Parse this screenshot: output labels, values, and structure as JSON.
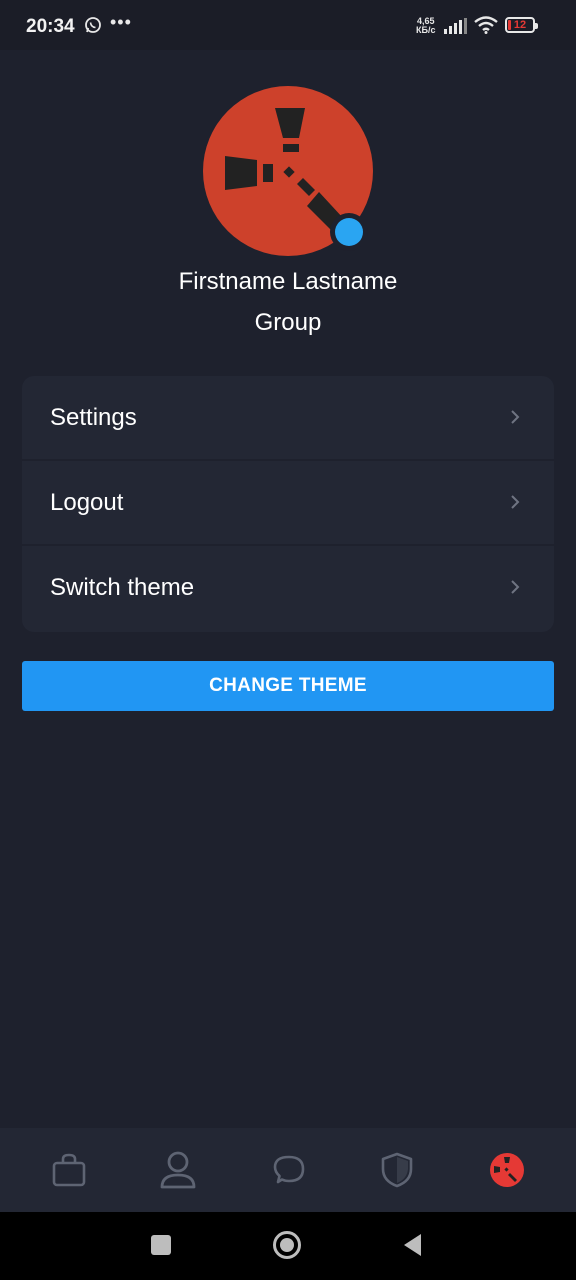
{
  "status_bar": {
    "time": "20:34",
    "network_speed_value": "4,65",
    "network_speed_unit": "КБ/с",
    "battery_level": "12",
    "icons": [
      "whatsapp-icon",
      "more-dots-icon",
      "signal-icon",
      "wifi-icon",
      "battery-icon"
    ]
  },
  "profile": {
    "name": "Firstname Lastname",
    "group": "Group",
    "status": "online",
    "avatar_color": "#cd412b",
    "status_color": "#2aa5f2"
  },
  "menu": {
    "items": [
      {
        "label": "Settings",
        "icon": "chevron-right-icon"
      },
      {
        "label": "Logout",
        "icon": "chevron-right-icon"
      },
      {
        "label": "Switch theme",
        "icon": "chevron-right-icon"
      }
    ]
  },
  "actions": {
    "change_theme_label": "CHANGE THEME",
    "accent_color": "#2196f3"
  },
  "bottom_nav": {
    "items": [
      {
        "name": "shop",
        "icon": "shopping-bag-icon"
      },
      {
        "name": "account",
        "icon": "user-icon"
      },
      {
        "name": "chat",
        "icon": "chat-bubble-icon"
      },
      {
        "name": "security",
        "icon": "shield-icon"
      },
      {
        "name": "profile",
        "icon": "avatar-icon",
        "active": true
      }
    ]
  },
  "system_nav": {
    "icons": [
      "recent-apps-icon",
      "home-icon",
      "back-icon"
    ]
  }
}
